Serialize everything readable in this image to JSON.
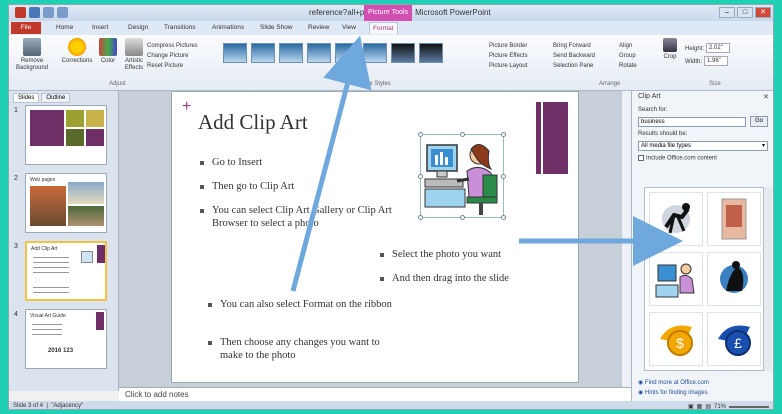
{
  "window": {
    "title": "reference?all+powerpoint[1] - Microsoft PowerPoint",
    "context_tab_title": "Picture Tools",
    "controls": [
      "–",
      "□",
      "✕"
    ]
  },
  "ribbon_tabs": [
    "File",
    "Home",
    "Insert",
    "Design",
    "Transitions",
    "Animations",
    "Slide Show",
    "Review",
    "View",
    "Format"
  ],
  "ribbon": {
    "remove_background": "Remove Background",
    "corrections": "Corrections",
    "color": "Color",
    "artistic_effects": "Artistic Effects",
    "adjust_items": [
      "Compress Pictures",
      "Change Picture",
      "Reset Picture"
    ],
    "adjust_group": "Adjust",
    "styles_group": "Picture Styles",
    "picture_items": [
      "Picture Border",
      "Picture Effects",
      "Picture Layout"
    ],
    "arrange_items": [
      "Bring Forward",
      "Send Backward",
      "Selection Pane"
    ],
    "align_items": [
      "Align",
      "Group",
      "Rotate"
    ],
    "arrange_group": "Arrange",
    "crop": "Crop",
    "height_label": "Height:",
    "height_value": "2.02\"",
    "width_label": "Width:",
    "width_value": "1.96\"",
    "size_group": "Size"
  },
  "left_pane": {
    "tab_slides": "Slides",
    "tab_outline": "Outline",
    "slide_numbers": [
      "1",
      "2",
      "3",
      "4"
    ],
    "thumb2_title": "Web pages",
    "thumb3_title": "Add Clip Art",
    "thumb4_title": "Visual Art Guide",
    "thumb4_numbers": "2016  123"
  },
  "slide": {
    "title": "Add Clip Art",
    "bullets": [
      "Go to Insert",
      "Then go to Clip Art",
      "You can select Clip Art Gallery or Clip Art Browser to select a photo",
      "Select the photo you want",
      "And then drag into the slide",
      "You can also select Format on the ribbon",
      "Then choose any changes you want to make to the photo"
    ]
  },
  "notes_placeholder": "Click to add notes",
  "clip_art_pane": {
    "title": "Clip Art",
    "close": "✕",
    "search_label": "Search for:",
    "search_value": "business",
    "go_button": "Go",
    "results_label": "Results should be:",
    "results_value": "All media file types",
    "include_label": "Include Office.com content",
    "link_more": "Find more at Office.com",
    "link_hints": "Hints for finding images"
  },
  "status": {
    "slide_info": "Slide 3 of 4",
    "theme": "\"Adjacency\"",
    "zoom": "71%"
  },
  "colors": {
    "accent_purple": "#6e2f66",
    "file_tab": "#c0392b",
    "context_tab": "#d04fb0",
    "frame_teal": "#1fd0b4",
    "arrow_blue": "#6fa8dc"
  }
}
